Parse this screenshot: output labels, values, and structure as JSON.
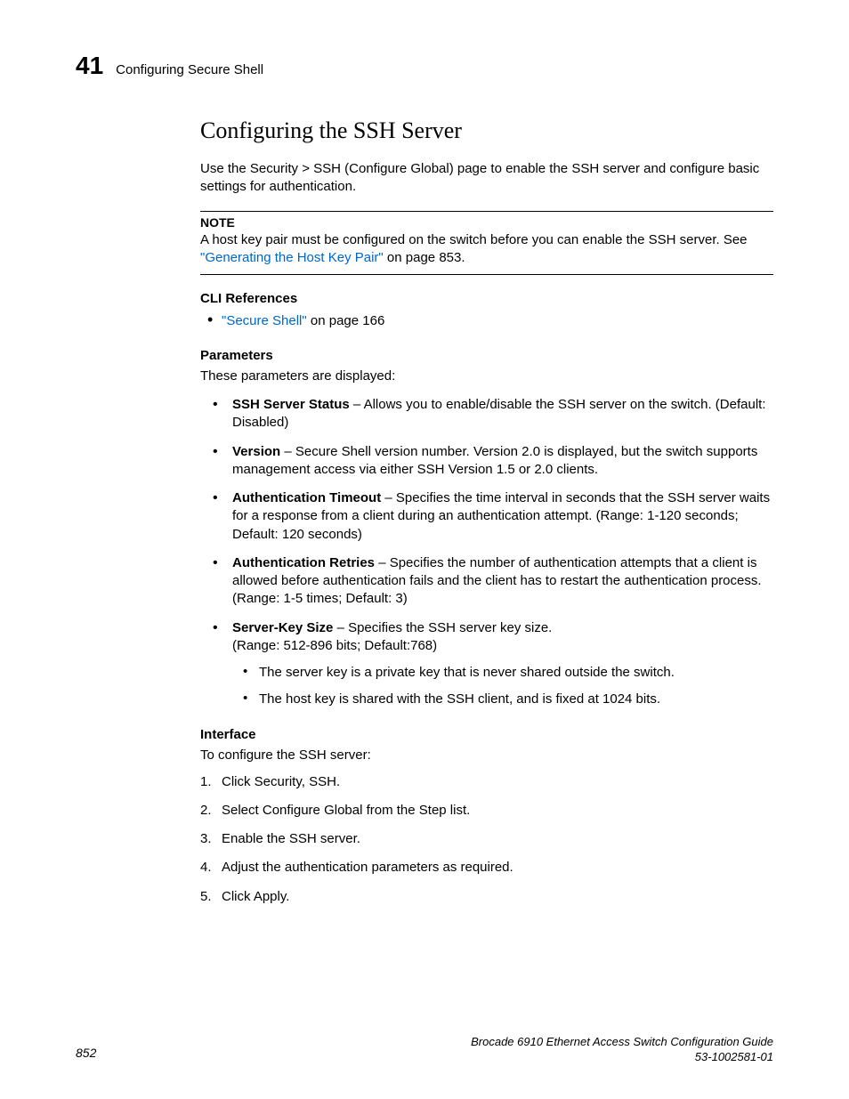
{
  "header": {
    "chapter_num": "41",
    "chapter_title": "Configuring Secure Shell"
  },
  "main_heading": "Configuring the SSH Server",
  "intro": "Use the Security > SSH (Configure Global) page to enable the SSH server and configure basic settings for authentication.",
  "note": {
    "title": "NOTE",
    "text_before": "A host key pair must be configured on the switch before you can enable the SSH server. See ",
    "link": "\"Generating the Host Key Pair\"",
    "text_after": " on page 853."
  },
  "cli": {
    "heading": "CLI References",
    "link": "\"Secure Shell\"",
    "text_after": " on page 166"
  },
  "params": {
    "heading": "Parameters",
    "intro": "These parameters are displayed:",
    "items": [
      {
        "name": "SSH Server Status",
        "desc": " – Allows you to enable/disable the SSH server on the switch. (Default: Disabled)"
      },
      {
        "name": "Version",
        "desc": " – Secure Shell version number. Version 2.0 is displayed, but the switch supports management access via either SSH Version 1.5 or 2.0 clients."
      },
      {
        "name": "Authentication Timeout",
        "desc": " – Specifies the time interval in seconds that the SSH server waits for a response from a client during an authentication attempt. (Range: 1-120 seconds; Default: 120 seconds)"
      },
      {
        "name": "Authentication Retries",
        "desc": " – Specifies the number of authentication attempts that a client is allowed before authentication fails and the client has to restart the authentication process. (Range: 1-5 times; Default: 3)"
      },
      {
        "name": "Server-Key Size",
        "desc_line1": " – Specifies the SSH server key size.",
        "desc_line2": "(Range: 512-896 bits; Default:768)",
        "subs": [
          "The server key is a private key that is never shared outside the switch.",
          "The host key is shared with the SSH client, and is fixed at 1024 bits."
        ]
      }
    ]
  },
  "interface": {
    "heading": "Interface",
    "intro": "To configure the SSH server:",
    "steps": [
      "Click Security, SSH.",
      "Select Configure Global from the Step list.",
      "Enable the SSH server.",
      "Adjust the authentication parameters as required.",
      "Click Apply."
    ]
  },
  "footer": {
    "page_num": "852",
    "guide": "Brocade 6910 Ethernet Access Switch Configuration Guide",
    "doc_id": "53-1002581-01"
  }
}
